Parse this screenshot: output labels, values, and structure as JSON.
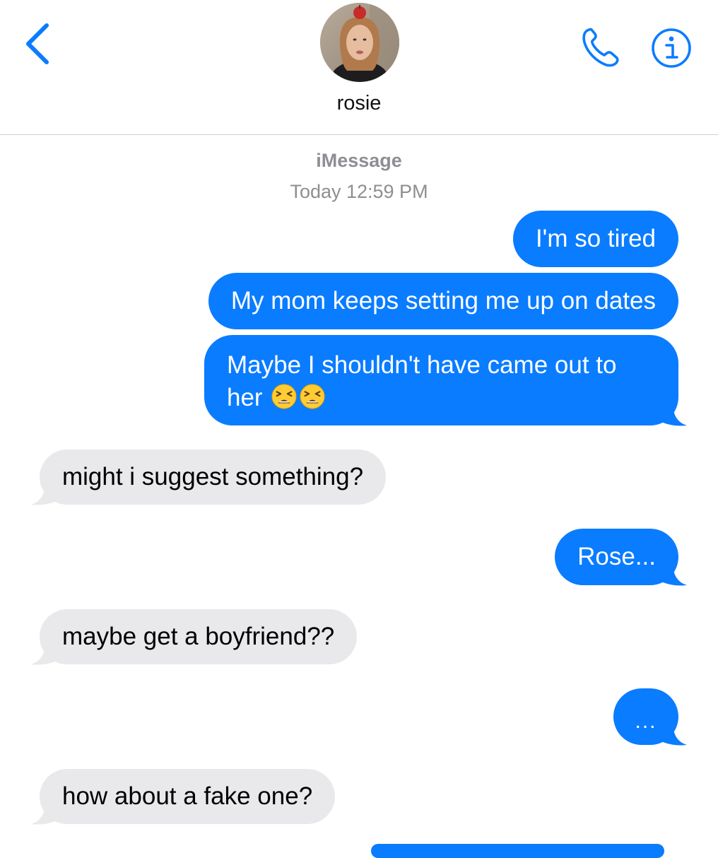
{
  "header": {
    "contact_name": "rosie",
    "icons": {
      "back": "chevron-left-icon",
      "phone": "phone-icon",
      "info": "info-icon"
    },
    "accent_color": "#0a7cff"
  },
  "thread": {
    "service": "iMessage",
    "timestamp": "Today 12:59 PM"
  },
  "messages": [
    {
      "from": "me",
      "text": "I'm so tired"
    },
    {
      "from": "me",
      "text": "My mom keeps setting me up on dates"
    },
    {
      "from": "me",
      "text": "Maybe I shouldn't have came out to her",
      "emoji": [
        "tired-face-emoji",
        "tired-face-emoji"
      ]
    },
    {
      "from": "them",
      "text": "might i suggest something?"
    },
    {
      "from": "me",
      "text": "Rose..."
    },
    {
      "from": "them",
      "text": "maybe get a boyfriend??"
    },
    {
      "from": "me",
      "text": "..."
    },
    {
      "from": "them",
      "text": "how about a fake one?"
    }
  ],
  "colors": {
    "sent_bubble": "#0a7cff",
    "received_bubble": "#e9e9eb",
    "meta_text": "#8e8e93"
  }
}
